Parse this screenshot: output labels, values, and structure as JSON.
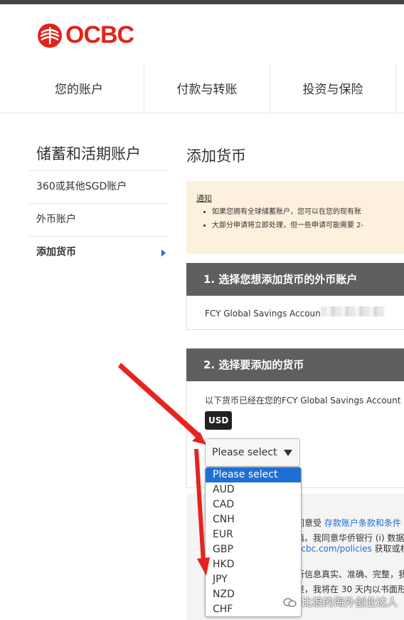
{
  "brand": {
    "name": "OCBC",
    "color": "#e2231a"
  },
  "nav": {
    "items": [
      "您的账户",
      "付款与转账",
      "投资与保险"
    ]
  },
  "sidebar": {
    "title": "储蓄和活期账户",
    "items": [
      {
        "label": "360或其他SGD账户"
      },
      {
        "label": "外币账户"
      },
      {
        "label": "添加货币",
        "active": true
      }
    ]
  },
  "main": {
    "title": "添加货币",
    "notice": {
      "title": "通知",
      "bullets": [
        "如果您拥有全球储蓄账户，您可以在您的现有账",
        "大部分申请将立即处理，但一些申请可能需要 2-"
      ]
    },
    "step1": {
      "header": "1. 选择您想添加货币的外币账户",
      "account": "FCY Global Savings Account 6"
    },
    "step2": {
      "header": "2. 选择要添加的货币",
      "existing_text": "以下货币已经在您的FCY Global Savings Account",
      "existing_badge": "USD",
      "select_value": "Please select",
      "options": [
        "Please select",
        "AUD",
        "CAD",
        "CNH",
        "EUR",
        "GBP",
        "HKD",
        "JPY",
        "NZD",
        "CHF"
      ]
    },
    "terms": {
      "line1_a": "同意受",
      "line1_link": "存款账户条款和条件",
      "line2": "篇。我同意华侨银行 (i) 数据",
      "line3_link": "ocbc.com/policies",
      "line3_b": "获取或根",
      "line4": "所信息真实、准确、完整，我",
      "line5": "整，我将在 30 天内以书面形"
    }
  },
  "watermark": {
    "text": "比浪的海外创业达人"
  },
  "colors": {
    "accent": "#1e70d5",
    "notice_bg": "#fdf0dc",
    "header_bg": "#5f5f5f",
    "arrow": "#e52420"
  }
}
